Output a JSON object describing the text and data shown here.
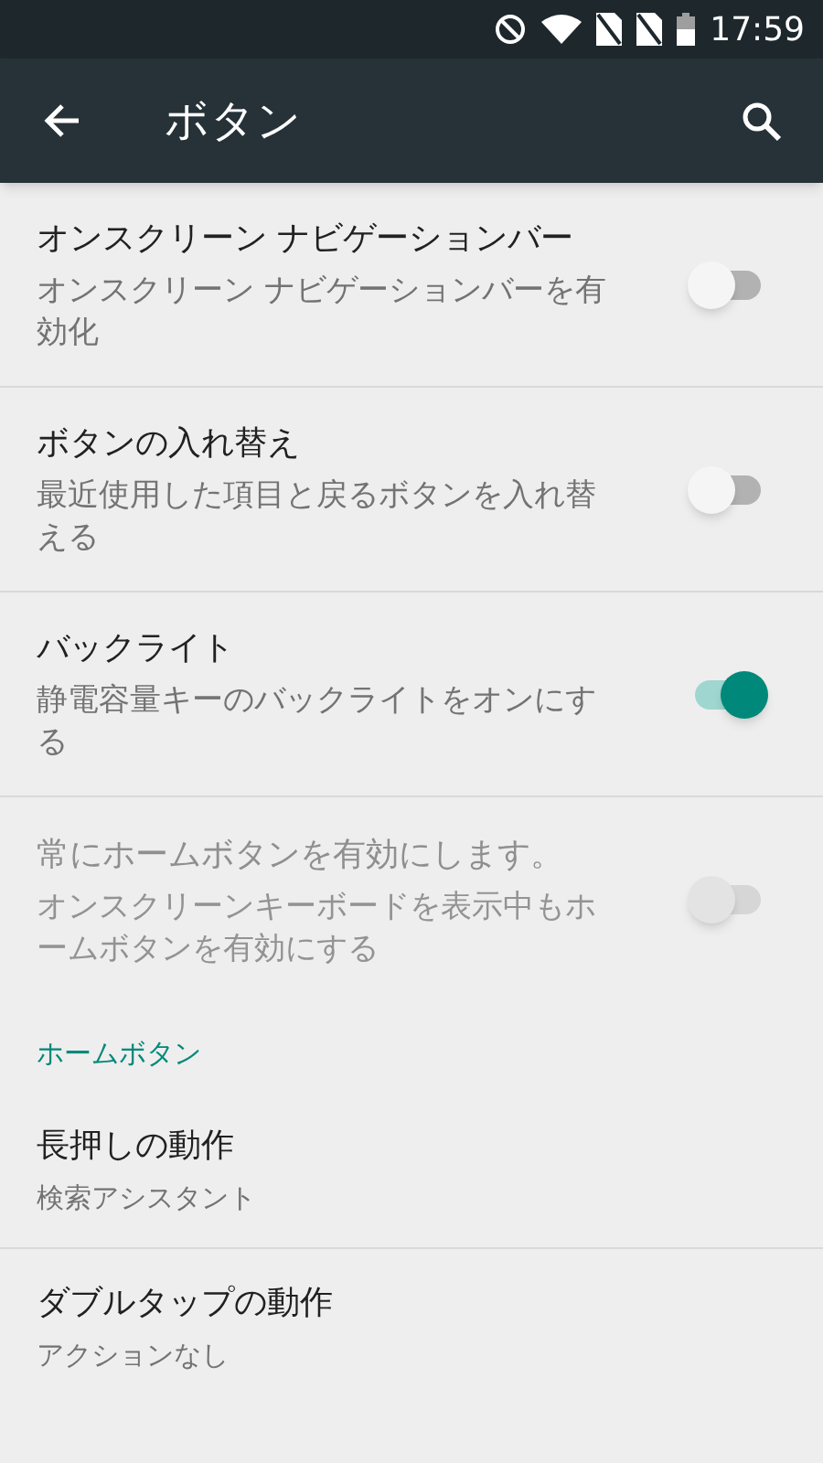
{
  "status_bar": {
    "time": "17:59"
  },
  "app_bar": {
    "title": "ボタン"
  },
  "settings": [
    {
      "kind": "switch",
      "title": "オンスクリーン ナビゲーションバー",
      "summary": "オンスクリーン ナビゲーションバーを有効化",
      "on": false,
      "disabled": false
    },
    {
      "kind": "switch",
      "title": "ボタンの入れ替え",
      "summary": "最近使用した項目と戻るボタンを入れ替える",
      "on": false,
      "disabled": false
    },
    {
      "kind": "switch",
      "title": "バックライト",
      "summary": "静電容量キーのバックライトをオンにする",
      "on": true,
      "disabled": false
    },
    {
      "kind": "switch",
      "title": "常にホームボタンを有効にします。",
      "summary": "オンスクリーンキーボードを表示中もホームボタンを有効にする",
      "on": false,
      "disabled": true
    },
    {
      "kind": "category",
      "title": "ホームボタン"
    },
    {
      "kind": "option",
      "title": "長押しの動作",
      "summary": "検索アシスタント"
    },
    {
      "kind": "option",
      "title": "ダブルタップの動作",
      "summary": "アクションなし"
    }
  ]
}
